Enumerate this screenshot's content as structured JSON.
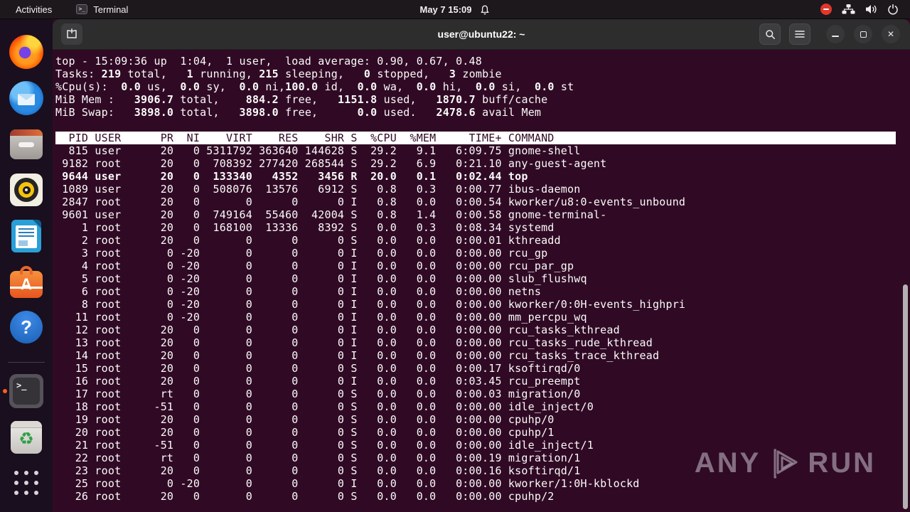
{
  "topbar": {
    "activities_label": "Activities",
    "app_name": "Terminal",
    "clock": "May 7 15:09",
    "icons": [
      "terminal-icon",
      "bell-icon",
      "record-indicator",
      "network-icon",
      "volume-icon",
      "power-icon"
    ]
  },
  "dock": {
    "items": [
      "firefox",
      "thunderbird",
      "files",
      "rhythmbox",
      "libreoffice-writer",
      "ubuntu-software",
      "help",
      "terminal",
      "trash",
      "app-grid"
    ],
    "running_app": "terminal"
  },
  "window": {
    "title": "user@ubuntu22: ~",
    "controls": [
      "new-tab",
      "search",
      "menu",
      "minimize",
      "maximize",
      "close"
    ]
  },
  "terminal": {
    "summary_lines": [
      [
        {
          "t": "top - 15:09:36 up  1:04,  1 user,  load average: 0.90, 0.67, 0.48",
          "b": false
        }
      ],
      [
        {
          "t": "Tasks: ",
          "b": false
        },
        {
          "t": "219",
          "b": true
        },
        {
          "t": " total, ",
          "b": false
        },
        {
          "t": "  1",
          "b": true
        },
        {
          "t": " running, ",
          "b": false
        },
        {
          "t": "215",
          "b": true
        },
        {
          "t": " sleeping, ",
          "b": false
        },
        {
          "t": "  0",
          "b": true
        },
        {
          "t": " stopped, ",
          "b": false
        },
        {
          "t": "  3",
          "b": true
        },
        {
          "t": " zombie",
          "b": false
        }
      ],
      [
        {
          "t": "%Cpu(s): ",
          "b": false
        },
        {
          "t": " 0.0",
          "b": true
        },
        {
          "t": " us, ",
          "b": false
        },
        {
          "t": " 0.0",
          "b": true
        },
        {
          "t": " sy, ",
          "b": false
        },
        {
          "t": " 0.0",
          "b": true
        },
        {
          "t": " ni,",
          "b": false
        },
        {
          "t": "100.0",
          "b": true
        },
        {
          "t": " id, ",
          "b": false
        },
        {
          "t": " 0.0",
          "b": true
        },
        {
          "t": " wa, ",
          "b": false
        },
        {
          "t": " 0.0",
          "b": true
        },
        {
          "t": " hi, ",
          "b": false
        },
        {
          "t": " 0.0",
          "b": true
        },
        {
          "t": " si, ",
          "b": false
        },
        {
          "t": " 0.0",
          "b": true
        },
        {
          "t": " st",
          "b": false
        }
      ],
      [
        {
          "t": "MiB Mem : ",
          "b": false
        },
        {
          "t": "  3906.7",
          "b": true
        },
        {
          "t": " total, ",
          "b": false
        },
        {
          "t": "   884.2",
          "b": true
        },
        {
          "t": " free, ",
          "b": false
        },
        {
          "t": "  1151.8",
          "b": true
        },
        {
          "t": " used, ",
          "b": false
        },
        {
          "t": "  1870.7",
          "b": true
        },
        {
          "t": " buff/cache",
          "b": false
        }
      ],
      [
        {
          "t": "MiB Swap: ",
          "b": false
        },
        {
          "t": "  3898.0",
          "b": true
        },
        {
          "t": " total, ",
          "b": false
        },
        {
          "t": "  3898.0",
          "b": true
        },
        {
          "t": " free, ",
          "b": false
        },
        {
          "t": "     0.0",
          "b": true
        },
        {
          "t": " used. ",
          "b": false
        },
        {
          "t": "  2478.6",
          "b": true
        },
        {
          "t": " avail Mem",
          "b": false
        }
      ]
    ],
    "columns": [
      "PID",
      "USER",
      "PR",
      "NI",
      "VIRT",
      "RES",
      "SHR",
      "S",
      "%CPU",
      "%MEM",
      "TIME+",
      "COMMAND"
    ],
    "header_line": "  PID USER      PR  NI    VIRT    RES    SHR S  %CPU  %MEM     TIME+ COMMAND",
    "header_width_chars": 128,
    "processes": [
      [
        "815",
        "user",
        "20",
        "0",
        "5311792",
        "363640",
        "144628",
        "S",
        "29.2",
        "9.1",
        "6:09.75",
        "gnome-shell"
      ],
      [
        "9182",
        "root",
        "20",
        "0",
        "708392",
        "277420",
        "268544",
        "S",
        "29.2",
        "6.9",
        "0:21.10",
        "any-guest-agent"
      ],
      [
        "9644",
        "user",
        "20",
        "0",
        "133340",
        "4352",
        "3456",
        "R",
        "20.0",
        "0.1",
        "0:02.44",
        "top"
      ],
      [
        "1089",
        "user",
        "20",
        "0",
        "508076",
        "13576",
        "6912",
        "S",
        "0.8",
        "0.3",
        "0:00.77",
        "ibus-daemon"
      ],
      [
        "2847",
        "root",
        "20",
        "0",
        "0",
        "0",
        "0",
        "I",
        "0.8",
        "0.0",
        "0:00.54",
        "kworker/u8:0-events_unbound"
      ],
      [
        "9601",
        "user",
        "20",
        "0",
        "749164",
        "55460",
        "42004",
        "S",
        "0.8",
        "1.4",
        "0:00.58",
        "gnome-terminal-"
      ],
      [
        "1",
        "root",
        "20",
        "0",
        "168100",
        "13336",
        "8392",
        "S",
        "0.0",
        "0.3",
        "0:08.34",
        "systemd"
      ],
      [
        "2",
        "root",
        "20",
        "0",
        "0",
        "0",
        "0",
        "S",
        "0.0",
        "0.0",
        "0:00.01",
        "kthreadd"
      ],
      [
        "3",
        "root",
        "0",
        "-20",
        "0",
        "0",
        "0",
        "I",
        "0.0",
        "0.0",
        "0:00.00",
        "rcu_gp"
      ],
      [
        "4",
        "root",
        "0",
        "-20",
        "0",
        "0",
        "0",
        "I",
        "0.0",
        "0.0",
        "0:00.00",
        "rcu_par_gp"
      ],
      [
        "5",
        "root",
        "0",
        "-20",
        "0",
        "0",
        "0",
        "I",
        "0.0",
        "0.0",
        "0:00.00",
        "slub_flushwq"
      ],
      [
        "6",
        "root",
        "0",
        "-20",
        "0",
        "0",
        "0",
        "I",
        "0.0",
        "0.0",
        "0:00.00",
        "netns"
      ],
      [
        "8",
        "root",
        "0",
        "-20",
        "0",
        "0",
        "0",
        "I",
        "0.0",
        "0.0",
        "0:00.00",
        "kworker/0:0H-events_highpri"
      ],
      [
        "11",
        "root",
        "0",
        "-20",
        "0",
        "0",
        "0",
        "I",
        "0.0",
        "0.0",
        "0:00.00",
        "mm_percpu_wq"
      ],
      [
        "12",
        "root",
        "20",
        "0",
        "0",
        "0",
        "0",
        "I",
        "0.0",
        "0.0",
        "0:00.00",
        "rcu_tasks_kthread"
      ],
      [
        "13",
        "root",
        "20",
        "0",
        "0",
        "0",
        "0",
        "I",
        "0.0",
        "0.0",
        "0:00.00",
        "rcu_tasks_rude_kthread"
      ],
      [
        "14",
        "root",
        "20",
        "0",
        "0",
        "0",
        "0",
        "I",
        "0.0",
        "0.0",
        "0:00.00",
        "rcu_tasks_trace_kthread"
      ],
      [
        "15",
        "root",
        "20",
        "0",
        "0",
        "0",
        "0",
        "S",
        "0.0",
        "0.0",
        "0:00.17",
        "ksoftirqd/0"
      ],
      [
        "16",
        "root",
        "20",
        "0",
        "0",
        "0",
        "0",
        "I",
        "0.0",
        "0.0",
        "0:03.45",
        "rcu_preempt"
      ],
      [
        "17",
        "root",
        "rt",
        "0",
        "0",
        "0",
        "0",
        "S",
        "0.0",
        "0.0",
        "0:00.03",
        "migration/0"
      ],
      [
        "18",
        "root",
        "-51",
        "0",
        "0",
        "0",
        "0",
        "S",
        "0.0",
        "0.0",
        "0:00.00",
        "idle_inject/0"
      ],
      [
        "19",
        "root",
        "20",
        "0",
        "0",
        "0",
        "0",
        "S",
        "0.0",
        "0.0",
        "0:00.00",
        "cpuhp/0"
      ],
      [
        "20",
        "root",
        "20",
        "0",
        "0",
        "0",
        "0",
        "S",
        "0.0",
        "0.0",
        "0:00.00",
        "cpuhp/1"
      ],
      [
        "21",
        "root",
        "-51",
        "0",
        "0",
        "0",
        "0",
        "S",
        "0.0",
        "0.0",
        "0:00.00",
        "idle_inject/1"
      ],
      [
        "22",
        "root",
        "rt",
        "0",
        "0",
        "0",
        "0",
        "S",
        "0.0",
        "0.0",
        "0:00.19",
        "migration/1"
      ],
      [
        "23",
        "root",
        "20",
        "0",
        "0",
        "0",
        "0",
        "S",
        "0.0",
        "0.0",
        "0:00.16",
        "ksoftirqd/1"
      ],
      [
        "25",
        "root",
        "0",
        "-20",
        "0",
        "0",
        "0",
        "I",
        "0.0",
        "0.0",
        "0:00.00",
        "kworker/1:0H-kblockd"
      ],
      [
        "26",
        "root",
        "20",
        "0",
        "0",
        "0",
        "0",
        "S",
        "0.0",
        "0.0",
        "0:00.00",
        "cpuhp/2"
      ]
    ],
    "bold_pids": [
      "9644"
    ]
  },
  "watermark": {
    "text_left": "ANY",
    "text_right": "RUN"
  },
  "colors": {
    "terminal_bg": "#300a24",
    "terminal_fg": "#fbfbfb",
    "header_bg": "#ffffff",
    "header_fg": "#300a24",
    "topbar_bg": "#1c181c",
    "titlebar_bg": "#2e2d2e",
    "dock_bg": "#1a0f1e",
    "accent_orange": "#e95420",
    "record_red": "#e0382b",
    "scrollbar": "#b5b0b6"
  }
}
